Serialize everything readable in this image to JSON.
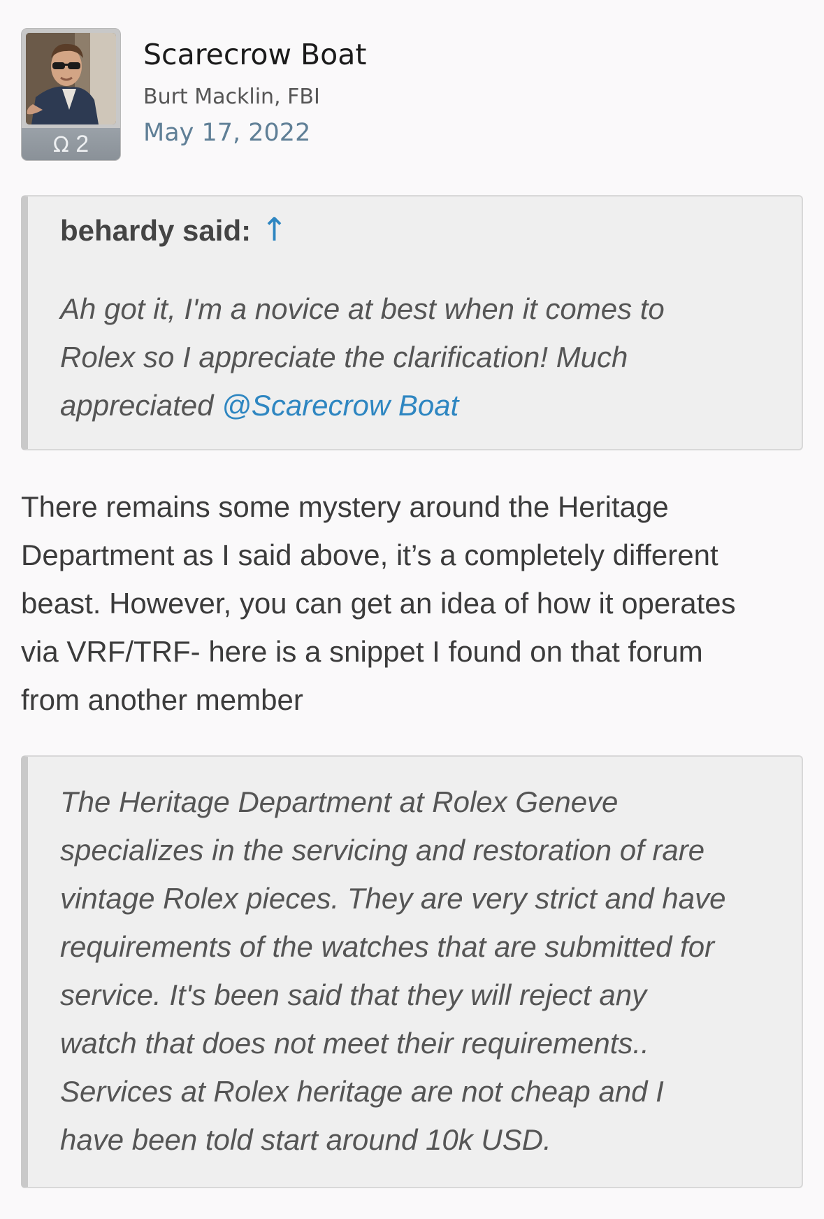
{
  "author": {
    "name": "Scarecrow Boat",
    "title": "Burt Macklin, FBI",
    "badge_symbol": "Ω",
    "badge_count": "2",
    "avatar_icon": "user-avatar-photo"
  },
  "post": {
    "date": "May 17, 2022",
    "quote1": {
      "author_label": "behardy said:",
      "arrow_icon": "↑",
      "lines": [
        "Ah got it, I'm a novice at best when it comes to",
        "Rolex so I appreciate the clarification! Much"
      ],
      "last_line_text": "appreciated ",
      "mention": "@Scarecrow Boat"
    },
    "body_lines": [
      "There remains some mystery around the Heritage",
      "Department as I said above, it’s a completely different",
      "beast. However, you can get an idea of how it operates",
      "via VRF/TRF- here is a snippet I found on that forum",
      "from another member"
    ],
    "quote2": {
      "lines": [
        "The Heritage Department at Rolex Geneve",
        "specializes in the servicing and restoration of rare",
        "vintage Rolex pieces. They are very strict and have",
        "requirements of the watches that are submitted for",
        "service. It's been said that they will reject any",
        "watch that does not meet their requirements..",
        "Services at Rolex heritage are not cheap and I",
        "have been told start around 10k USD."
      ]
    }
  },
  "colors": {
    "background": "#faf9fa",
    "link": "#2e86c1",
    "date": "#5f7f96",
    "quote_bg": "#efefef"
  }
}
